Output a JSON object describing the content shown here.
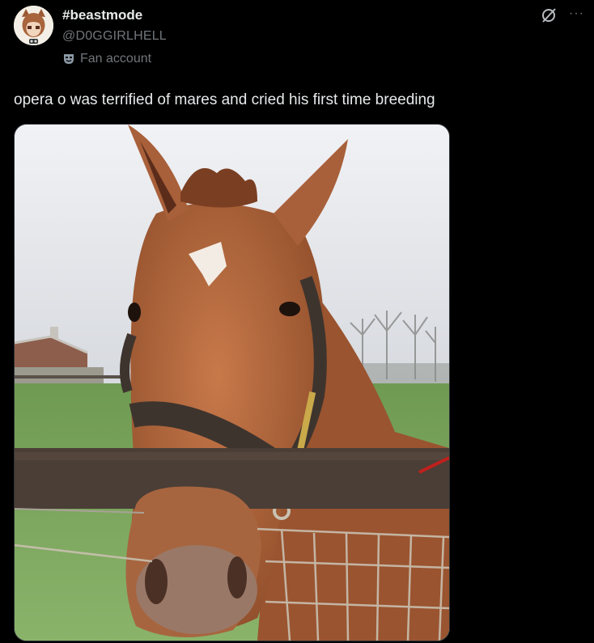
{
  "author": {
    "display_name": "#beastmode",
    "handle": "@D0GGIRLHELL",
    "avatar_icon": "anime-character-avatar",
    "label": "Fan account",
    "label_icon": "theater-mask-icon"
  },
  "actions": {
    "grok_icon": "grok-icon",
    "more_label": "···"
  },
  "post": {
    "text": "opera o was terrified of mares and cried his first time breeding"
  },
  "media": {
    "description_icon": "horse-photo"
  },
  "colors": {
    "background": "#000000",
    "text_primary": "#e7e9ea",
    "text_secondary": "#71767b"
  }
}
